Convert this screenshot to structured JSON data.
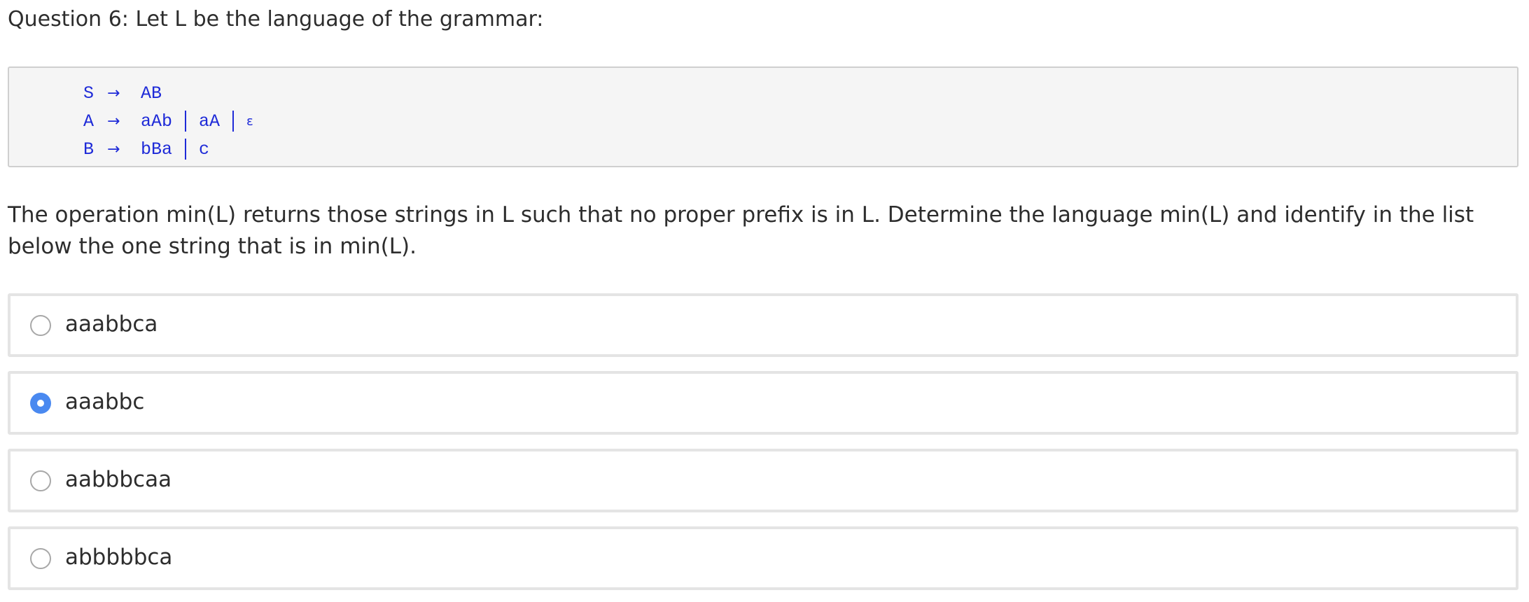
{
  "question": {
    "title": "Question 6: Let L be the language of the grammar:"
  },
  "grammar": {
    "arrow": "→",
    "productions": [
      {
        "lhs": "S",
        "alternatives": [
          "AB"
        ]
      },
      {
        "lhs": "A",
        "alternatives": [
          "aAb",
          "aA",
          "ε"
        ]
      },
      {
        "lhs": "B",
        "alternatives": [
          "bBa",
          "c"
        ]
      }
    ]
  },
  "prompt": "The operation min(L) returns those strings in L such that no proper prefix is in L. Determine the language min(L) and identify in the list below the one string that is in min(L).",
  "options": [
    {
      "label": "aaabbca",
      "selected": false
    },
    {
      "label": "aaabbc",
      "selected": true
    },
    {
      "label": "aabbbcaa",
      "selected": false
    },
    {
      "label": "abbbbbca",
      "selected": false
    }
  ],
  "colors": {
    "grammar_text": "#1f2bd8",
    "selected_radio": "#4a89f0",
    "option_border": "#e4e4e4",
    "grammar_background": "#f5f5f5"
  }
}
